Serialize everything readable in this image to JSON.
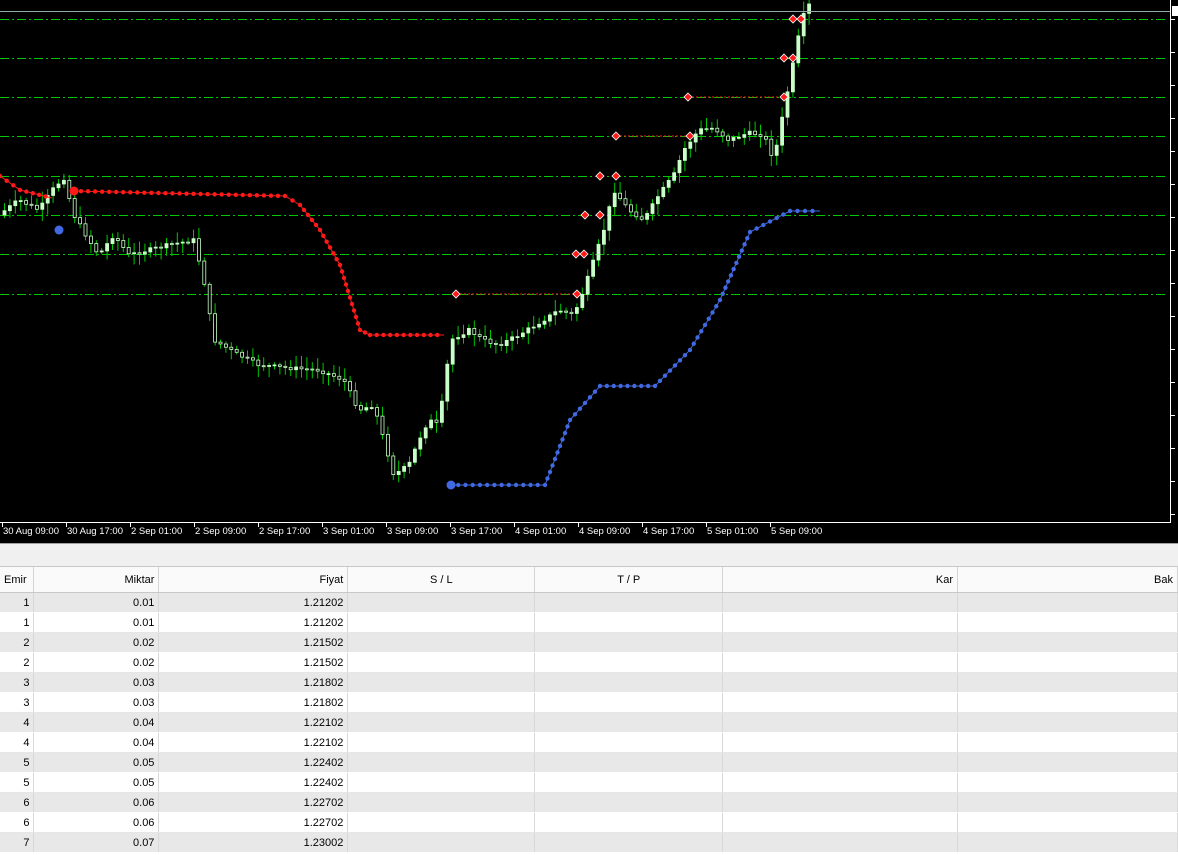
{
  "chart": {
    "background": "#000000",
    "grid_color": "#00c800",
    "bull_color": "#c8ffc8",
    "bear_color": "#00c800",
    "upper_line_color": "#ff1a1a",
    "lower_line_color": "#4169e1",
    "time_labels": [
      "30 Aug 09:00",
      "30 Aug 17:00",
      "2 Sep 01:00",
      "2 Sep 09:00",
      "2 Sep 17:00",
      "3 Sep 01:00",
      "3 Sep 09:00",
      "3 Sep 17:00",
      "4 Sep 01:00",
      "4 Sep 09:00",
      "4 Sep 17:00",
      "5 Sep 01:00",
      "5 Sep 09:00"
    ]
  },
  "table": {
    "headers": {
      "emir": "Emir",
      "miktar": "Miktar",
      "fiyat": "Fiyat",
      "sl": "S / L",
      "tp": "T / P",
      "kar": "Kar",
      "bak": "Bak"
    },
    "rows": [
      {
        "emir": "1",
        "miktar": "0.01",
        "fiyat": "1.21202"
      },
      {
        "emir": "1",
        "miktar": "0.01",
        "fiyat": "1.21202"
      },
      {
        "emir": "2",
        "miktar": "0.02",
        "fiyat": "1.21502"
      },
      {
        "emir": "2",
        "miktar": "0.02",
        "fiyat": "1.21502"
      },
      {
        "emir": "3",
        "miktar": "0.03",
        "fiyat": "1.21802"
      },
      {
        "emir": "3",
        "miktar": "0.03",
        "fiyat": "1.21802"
      },
      {
        "emir": "4",
        "miktar": "0.04",
        "fiyat": "1.22102"
      },
      {
        "emir": "4",
        "miktar": "0.04",
        "fiyat": "1.22102"
      },
      {
        "emir": "5",
        "miktar": "0.05",
        "fiyat": "1.22402"
      },
      {
        "emir": "5",
        "miktar": "0.05",
        "fiyat": "1.22402"
      },
      {
        "emir": "6",
        "miktar": "0.06",
        "fiyat": "1.22702"
      },
      {
        "emir": "6",
        "miktar": "0.06",
        "fiyat": "1.22702"
      },
      {
        "emir": "7",
        "miktar": "0.07",
        "fiyat": "1.23002"
      }
    ]
  }
}
